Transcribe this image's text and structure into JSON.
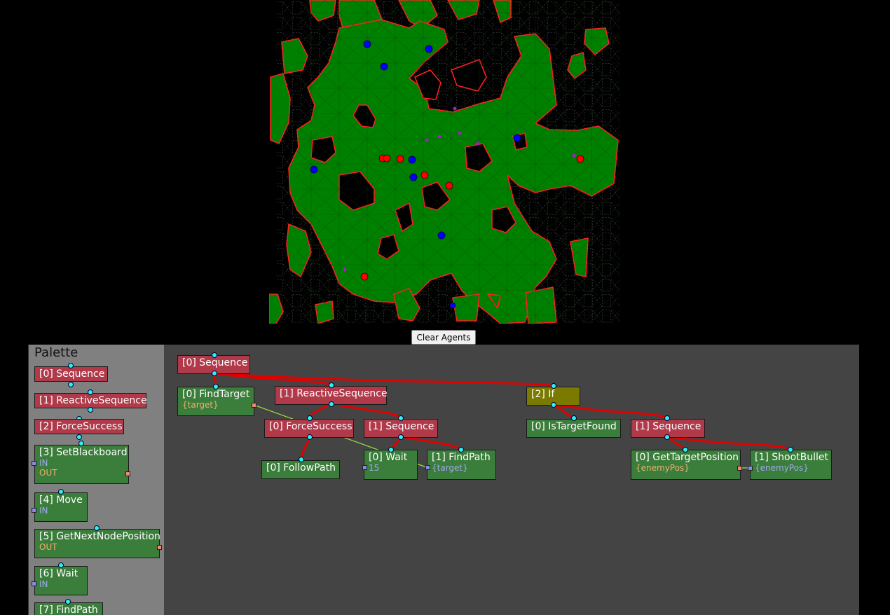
{
  "app": {
    "clear_button": "Clear Agents"
  },
  "palette": {
    "title": "Palette",
    "items": [
      {
        "label": "[0] Sequence"
      },
      {
        "label": "[1] ReactiveSequence"
      },
      {
        "label": "[2] ForceSuccess"
      },
      {
        "label": "[3] SetBlackboard",
        "in": "IN",
        "out": "OUT"
      },
      {
        "label": "[4] Move",
        "in": "IN"
      },
      {
        "label": "[5] GetNextNodePosition",
        "out": "OUT"
      },
      {
        "label": "[6] Wait",
        "in": "IN"
      },
      {
        "label": "[7] FindPath"
      }
    ]
  },
  "tree": {
    "root": {
      "label": "[0] Sequence"
    },
    "find_target": {
      "label": "[0] FindTarget",
      "param": "{target}"
    },
    "reactive_sequence": {
      "label": "[1] ReactiveSequence"
    },
    "force_success": {
      "label": "[0] ForceSuccess"
    },
    "follow_path": {
      "label": "[0] FollowPath"
    },
    "inner_sequence": {
      "label": "[1] Sequence"
    },
    "wait": {
      "label": "[0] Wait",
      "param": "15"
    },
    "find_path": {
      "label": "[1] FindPath",
      "param": "{target}"
    },
    "if_node": {
      "label": "[2] If"
    },
    "is_target_found": {
      "label": "[0] IsTargetFound"
    },
    "attack_sequence": {
      "label": "[1] Sequence"
    },
    "get_target_position": {
      "label": "[0] GetTargetPosition",
      "param": "{enemyPos}"
    },
    "shoot_bullet": {
      "label": "[1] ShootBullet",
      "param": "{enemyPos}"
    }
  },
  "colors": {
    "map_background": "#000000",
    "walkable": "#008000",
    "wall_edge": "#ff2020",
    "navmesh": "#c8c8c8",
    "agent_blue": "#0000ff",
    "agent_red": "#ff0000",
    "waypoint": "#a020c0",
    "composite_node": "#b03a4a",
    "action_node": "#3b7d3b",
    "condition_node": "#7a7a00",
    "link": "#e00000",
    "data_link": "#a0e040"
  }
}
